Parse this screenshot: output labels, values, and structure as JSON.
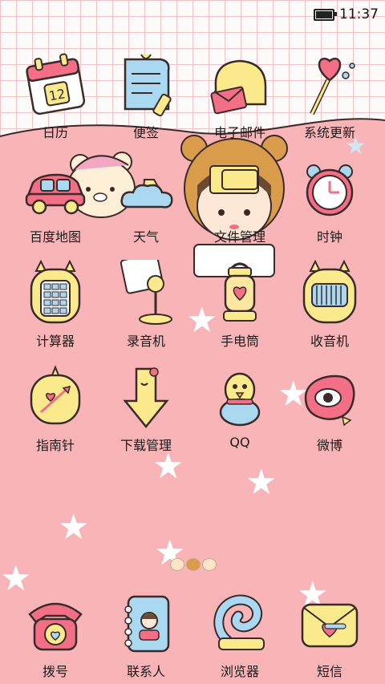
{
  "status_bar": {
    "time": "11:37"
  },
  "colors": {
    "background_pink": "#f8b4b6",
    "grid": "#f1c3c8",
    "icon_yellow": "#fbea8b",
    "icon_pink": "#f26f85",
    "icon_blue": "#a9d8f0"
  },
  "rows": [
    [
      {
        "label": "日历",
        "icon": "calendar-icon"
      },
      {
        "label": "便签",
        "icon": "notepad-icon"
      },
      {
        "label": "电子邮件",
        "icon": "mail-icon"
      },
      {
        "label": "系统更新",
        "icon": "lollipop-icon"
      }
    ],
    [
      {
        "label": "百度地图",
        "icon": "car-icon"
      },
      {
        "label": "天气",
        "icon": "cloud-icon"
      },
      {
        "label": "文件管理",
        "icon": "folder-icon"
      },
      {
        "label": "时钟",
        "icon": "clock-icon"
      }
    ],
    [
      {
        "label": "计算器",
        "icon": "calculator-icon"
      },
      {
        "label": "录音机",
        "icon": "microphone-icon"
      },
      {
        "label": "手电筒",
        "icon": "lantern-icon"
      },
      {
        "label": "收音机",
        "icon": "radio-icon"
      }
    ],
    [
      {
        "label": "指南针",
        "icon": "compass-icon"
      },
      {
        "label": "下载管理",
        "icon": "download-icon"
      },
      {
        "label": "QQ",
        "icon": "penguin-icon"
      },
      {
        "label": "微博",
        "icon": "weibo-icon"
      }
    ]
  ],
  "dock": [
    {
      "label": "拨号",
      "icon": "telephone-icon"
    },
    {
      "label": "联系人",
      "icon": "contacts-book-icon"
    },
    {
      "label": "浏览器",
      "icon": "browser-icon"
    },
    {
      "label": "短信",
      "icon": "envelope-icon"
    }
  ],
  "page_indicator": {
    "pages": 3,
    "current": 2
  }
}
